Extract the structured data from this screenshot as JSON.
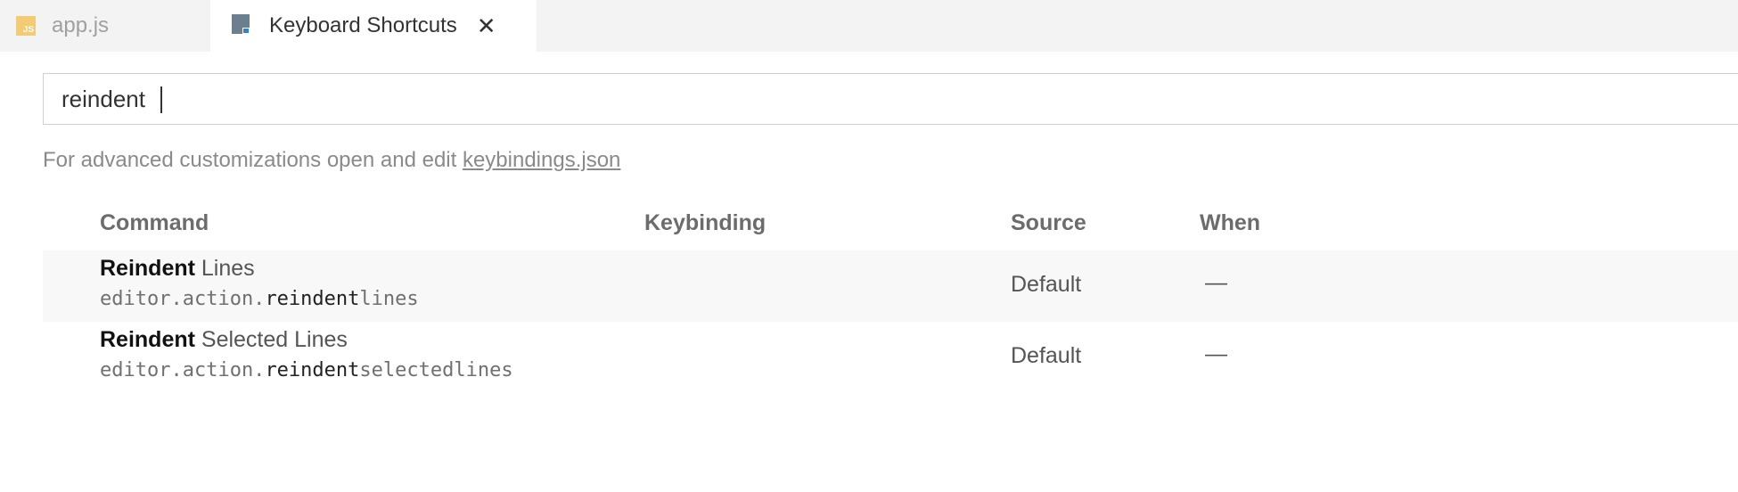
{
  "tabs": [
    {
      "label": "app.js",
      "icon": "js-file-icon",
      "icon_text": "JS"
    },
    {
      "label": "Keyboard Shortcuts",
      "icon": "keyboard-shortcuts-icon",
      "close": "✕"
    }
  ],
  "search": {
    "value": "reindent",
    "placeholder": ""
  },
  "hint": {
    "text": "For advanced customizations open and edit ",
    "link": "keybindings.json"
  },
  "columns": {
    "command": "Command",
    "keybinding": "Keybinding",
    "source": "Source",
    "when": "When"
  },
  "rows": [
    {
      "title_match": "Reindent",
      "title_rest": " Lines",
      "id_prefix": "editor.action.",
      "id_match": "reindent",
      "id_rest": "lines",
      "keybinding": "",
      "source": "Default",
      "when": "—"
    },
    {
      "title_match": "Reindent",
      "title_rest": " Selected Lines",
      "id_prefix": "editor.action.",
      "id_match": "reindent",
      "id_rest": "selectedlines",
      "keybinding": "",
      "source": "Default",
      "when": "—"
    }
  ],
  "colors": {
    "tabbar_bg": "#f3f3f3",
    "js_icon": "#f2c55c",
    "doc_icon": "#6b7f8e",
    "alt_row_bg": "#f8f8f8"
  }
}
